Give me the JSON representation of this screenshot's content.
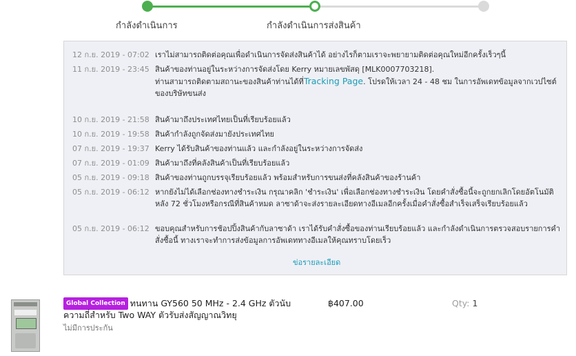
{
  "progress": {
    "steps": [
      {
        "label": "กำลังดำเนินการ",
        "state": "done"
      },
      {
        "label": "กำลังดำเนินการส่งสินค้า",
        "state": "current"
      },
      {
        "label": "",
        "state": "pending"
      }
    ],
    "colors": {
      "done": "#4CAF50",
      "pending": "#dadada"
    }
  },
  "tracking": {
    "events": [
      {
        "time": "12 ก.ย. 2019 - 07:02",
        "message": "เราไม่สามารถติดต่อคุณเพื่อดำเนินการจัดส่งสินค้าได้ อย่างไรก็ตามเราจะพยายามติดต่อคุณใหม่อีกครั้งเร็วๆนี้"
      },
      {
        "time": "11 ก.ย. 2019 - 23:45",
        "message_line1": "สินค้าของท่านอยู่ในระหว่างการจัดส่งโดย Kerry หมายเลขพัสดุ [MLK0007703218].",
        "message_pre": "ท่านสามารถติดตามสถานะของสินค้าท่านได้ที่",
        "link_text": "Tracking Page",
        "message_post": ". โปรดให้เวลา 24 - 48 ชม ในการอัพเดทข้อมูลจากเวปไซต์ของบริษัทขนส่ง"
      },
      {
        "time": "10 ก.ย. 2019 - 21:58",
        "message": "สินค้ามาถึงประเทศไทยเป็นที่เรียบร้อยแล้ว"
      },
      {
        "time": "10 ก.ย. 2019 - 19:58",
        "message": "สินค้ากำลังถูกจัดส่งมายังประเทศไทย"
      },
      {
        "time": "07 ก.ย. 2019 - 19:37",
        "message": "Kerry ได้รับสินค้าของท่านแล้ว และกำลังอยู่ในระหว่างการจัดส่ง"
      },
      {
        "time": "07 ก.ย. 2019 - 01:09",
        "message": "สินค้ามาถึงที่คลังสินค้าเป็นที่เรียบร้อยแล้ว"
      },
      {
        "time": "05 ก.ย. 2019 - 09:18",
        "message": "สินค้าของท่านถูกบรรจุเรียบร้อยแล้ว พร้อมสำหรับการขนส่งที่คลังสินค้าของร้านค้า"
      },
      {
        "time": "05 ก.ย. 2019 - 06:12",
        "message": "หากยังไม่ได้เลือกช่องทางชำระเงิน กรุณาคลิก 'ชำระเงิน' เพื่อเลือกช่องทางชำระเงิน โดยคำสั่งซื้อนี้จะถูกยกเลิกโดยอัตโนมัติหลัง 72 ชั่วโมงหรือกรณีที่สินค้าหมด ลาซาด้าจะส่งรายละเอียดทางอีเมลอีกครั้งเมื่อคำสั่งซื้อสำเร็จเสร็จเรียบร้อยแล้ว"
      },
      {
        "time": "05 ก.ย. 2019 - 06:12",
        "message": "ขอบคุณสำหรับการช้อปปิ้งสินค้ากับลาซาด้า เราได้รับคำสั่งซื้อของท่านเรียบร้อยแล้ว และกำลังดำเนินการตรวจสอบรายการคำสั่งซื้อนี้ ทางเราจะทำการส่งข้อมูลการอัพเดททางอีเมลให้คุณทราบโดยเร็ว"
      }
    ],
    "details_link": "ข่อรายละเอียด",
    "link_color": "#1a9cb7"
  },
  "product": {
    "badge": "Global Collection",
    "badge_color": "#b620e0",
    "name": "ทนทาน GY560 50 MHz - 2.4 GHz ตัวนับความถี่สำหรับ Two WAY ตัวรับส่งสัญญาณวิทยุ",
    "warranty": "ไม่มีการประกัน",
    "price": "฿407.00",
    "qty_label": "Qty:",
    "qty_value": "1"
  }
}
